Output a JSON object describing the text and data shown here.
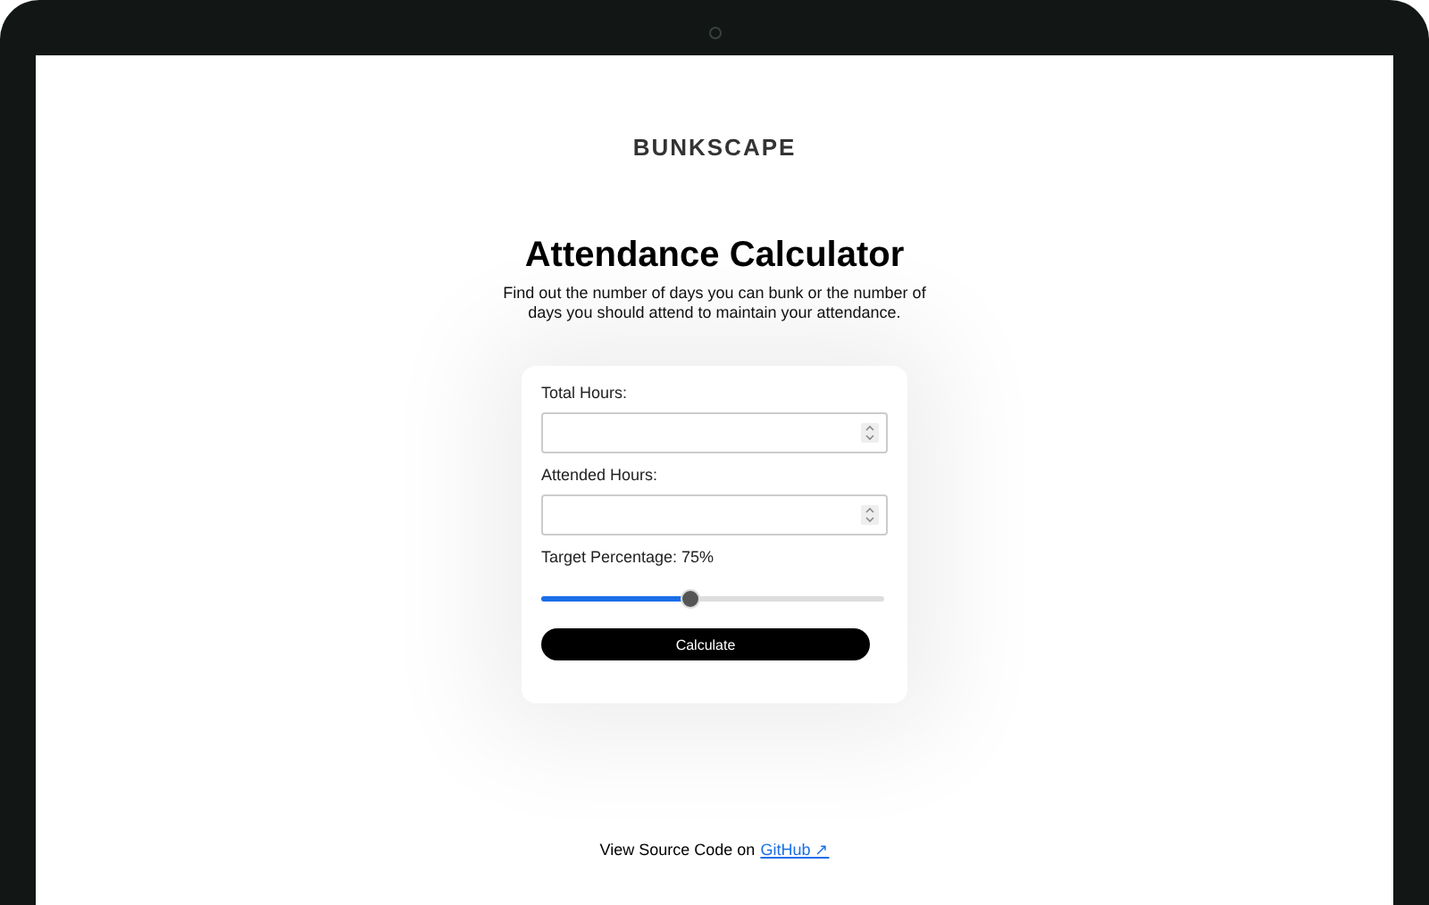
{
  "logo": "BUNKSCAPE",
  "title": "Attendance Calculator",
  "subtitle": "Find out the number of days you can bunk or the number of days you should attend to maintain your attendance.",
  "form": {
    "fields": [
      {
        "label": "Total Hours:"
      },
      {
        "label": "Attended Hours:"
      }
    ],
    "slider": {
      "label": "Target Percentage: 75%",
      "level": 0.43
    },
    "button": "Calculate"
  },
  "footer": {
    "text": "View Source Code on",
    "link": "GitHub ↗"
  }
}
